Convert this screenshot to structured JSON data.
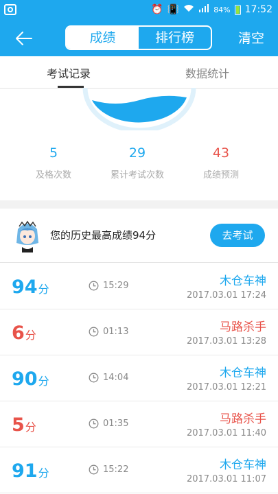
{
  "status_bar": {
    "battery_percent": "84%",
    "time": "17:52"
  },
  "nav": {
    "seg_scores": "成绩",
    "seg_ranking": "排行榜",
    "clear": "清空"
  },
  "tabs": {
    "record": "考试记录",
    "stats": "数据统计"
  },
  "stats": [
    {
      "value": "5",
      "label": "及格次数",
      "color": "#1ea8ee"
    },
    {
      "value": "29",
      "label": "累计考试次数",
      "color": "#1ea8ee"
    },
    {
      "value": "43",
      "label": "成绩预测",
      "color": "#e8534a"
    }
  ],
  "best": {
    "text": "您的历史最高成绩94分",
    "button": "去考试"
  },
  "records": [
    {
      "score": "94",
      "unit": "分",
      "duration": "15:29",
      "title": "木仓车神",
      "date": "2017.03.01  17:24",
      "color": "#1ea8ee"
    },
    {
      "score": "6",
      "unit": "分",
      "duration": "01:13",
      "title": "马路杀手",
      "date": "2017.03.01  13:28",
      "color": "#e8534a"
    },
    {
      "score": "90",
      "unit": "分",
      "duration": "14:04",
      "title": "木仓车神",
      "date": "2017.03.01  12:21",
      "color": "#1ea8ee"
    },
    {
      "score": "5",
      "unit": "分",
      "duration": "01:35",
      "title": "马路杀手",
      "date": "2017.03.01  11:40",
      "color": "#e8534a"
    },
    {
      "score": "91",
      "unit": "分",
      "duration": "15:22",
      "title": "木仓车神",
      "date": "2017.03.01  11:07",
      "color": "#1ea8ee"
    }
  ],
  "colors": {
    "primary": "#1ea8ee",
    "fail": "#e8534a"
  }
}
